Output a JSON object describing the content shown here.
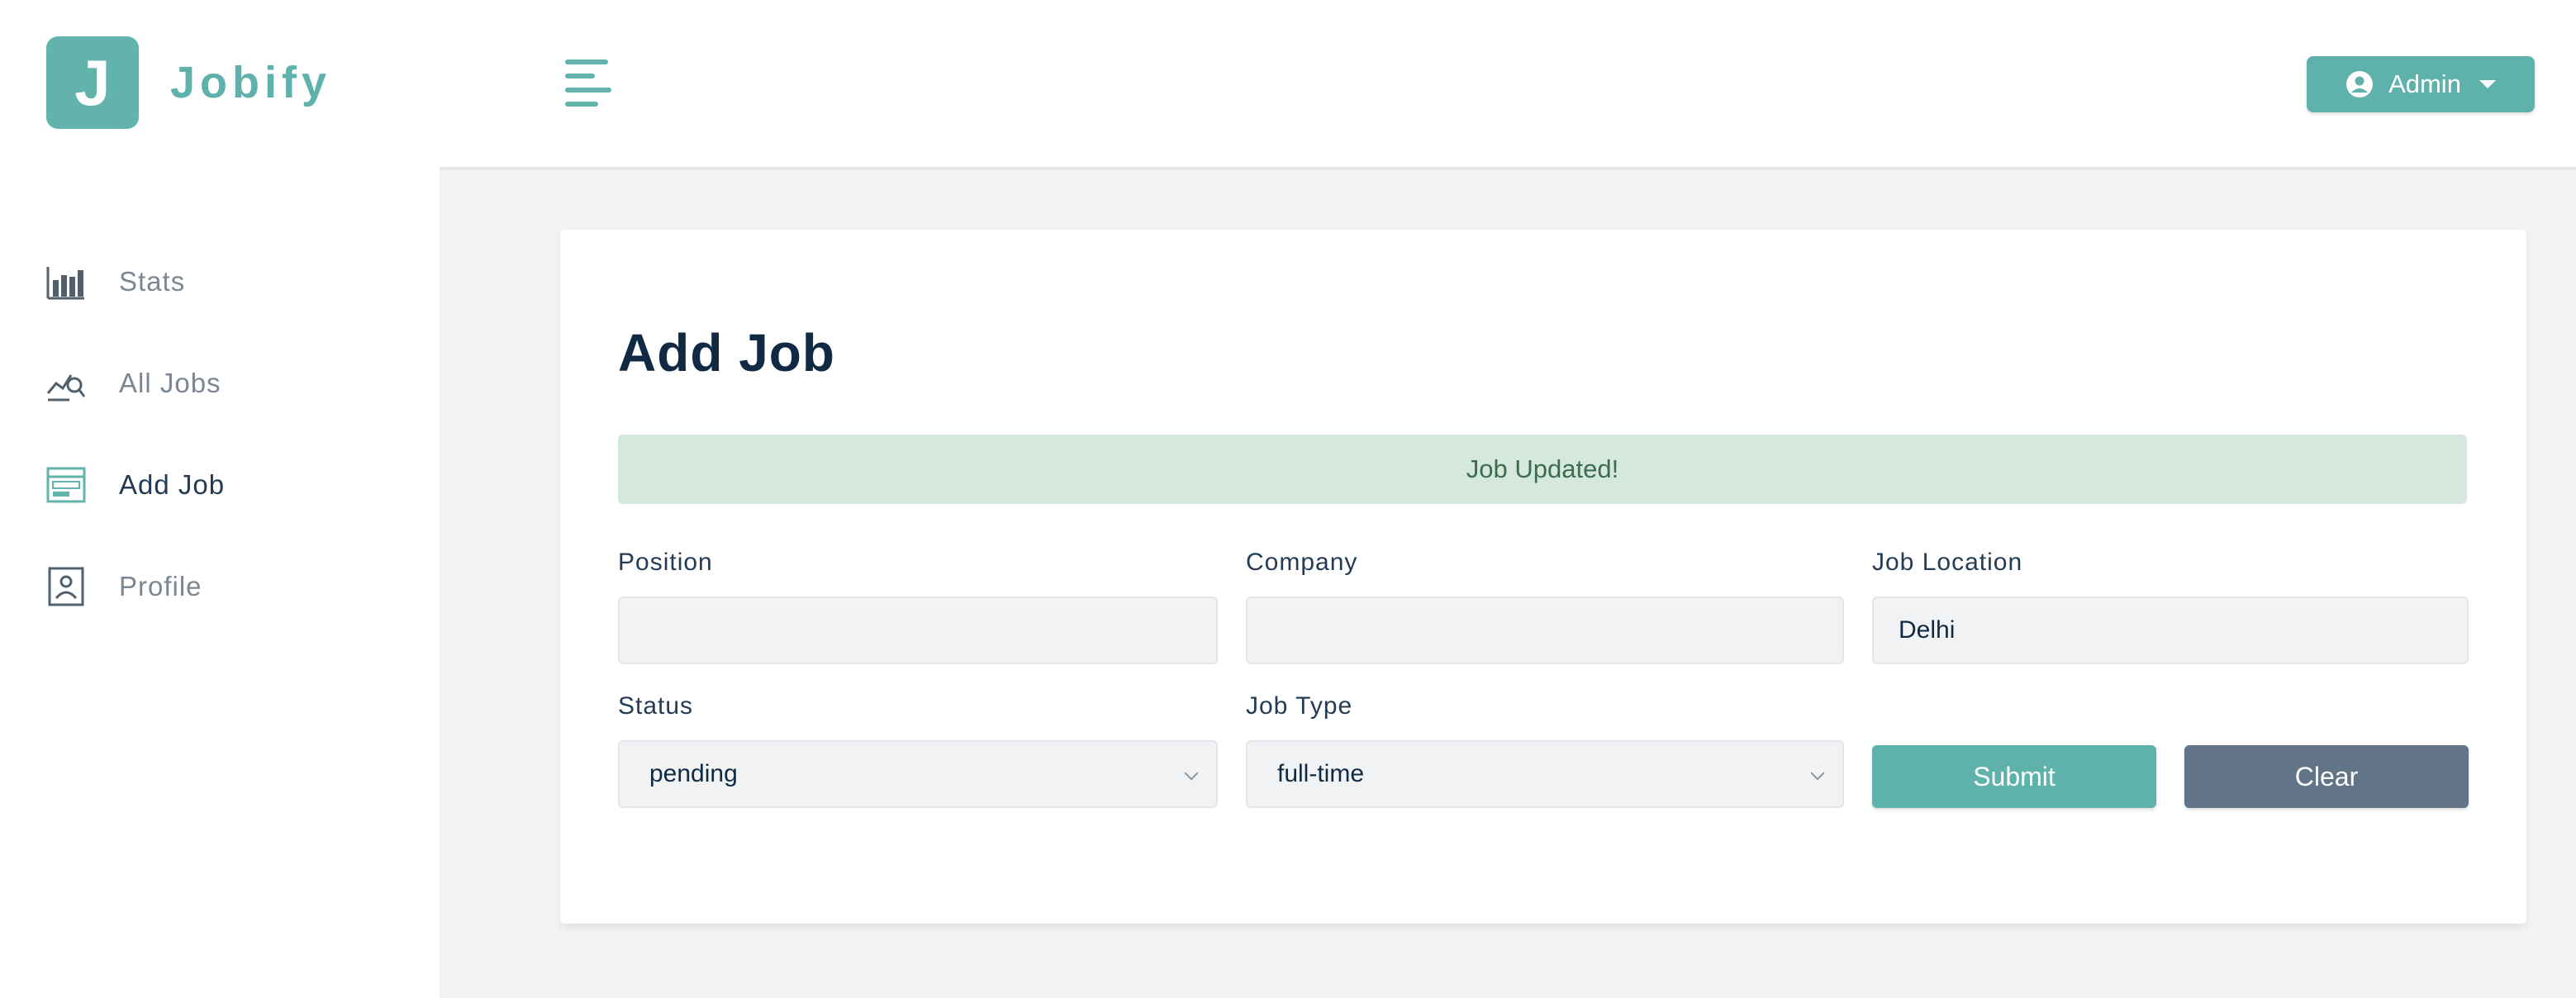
{
  "brand": {
    "logo_letter": "J",
    "name": "Jobify"
  },
  "sidebar": {
    "items": [
      {
        "label": "Stats",
        "icon": "bar-chart-icon"
      },
      {
        "label": "All Jobs",
        "icon": "query-stats-icon"
      },
      {
        "label": "Add Job",
        "icon": "form-icon"
      },
      {
        "label": "Profile",
        "icon": "profile-card-icon"
      }
    ],
    "active_index": 2
  },
  "header": {
    "user_button_label": "Admin"
  },
  "form": {
    "title": "Add Job",
    "alert": "Job Updated!",
    "fields": {
      "position": {
        "label": "Position",
        "value": ""
      },
      "company": {
        "label": "Company",
        "value": ""
      },
      "location": {
        "label": "Job Location",
        "value": "Delhi"
      },
      "status": {
        "label": "Status",
        "value": "pending"
      },
      "job_type": {
        "label": "Job Type",
        "value": "full-time"
      }
    },
    "submit_label": "Submit",
    "clear_label": "Clear"
  },
  "colors": {
    "primary": "#5fb1ab",
    "alert_bg": "#d4e8dd",
    "clear_button": "#627487",
    "background": "#f2f3f4"
  }
}
